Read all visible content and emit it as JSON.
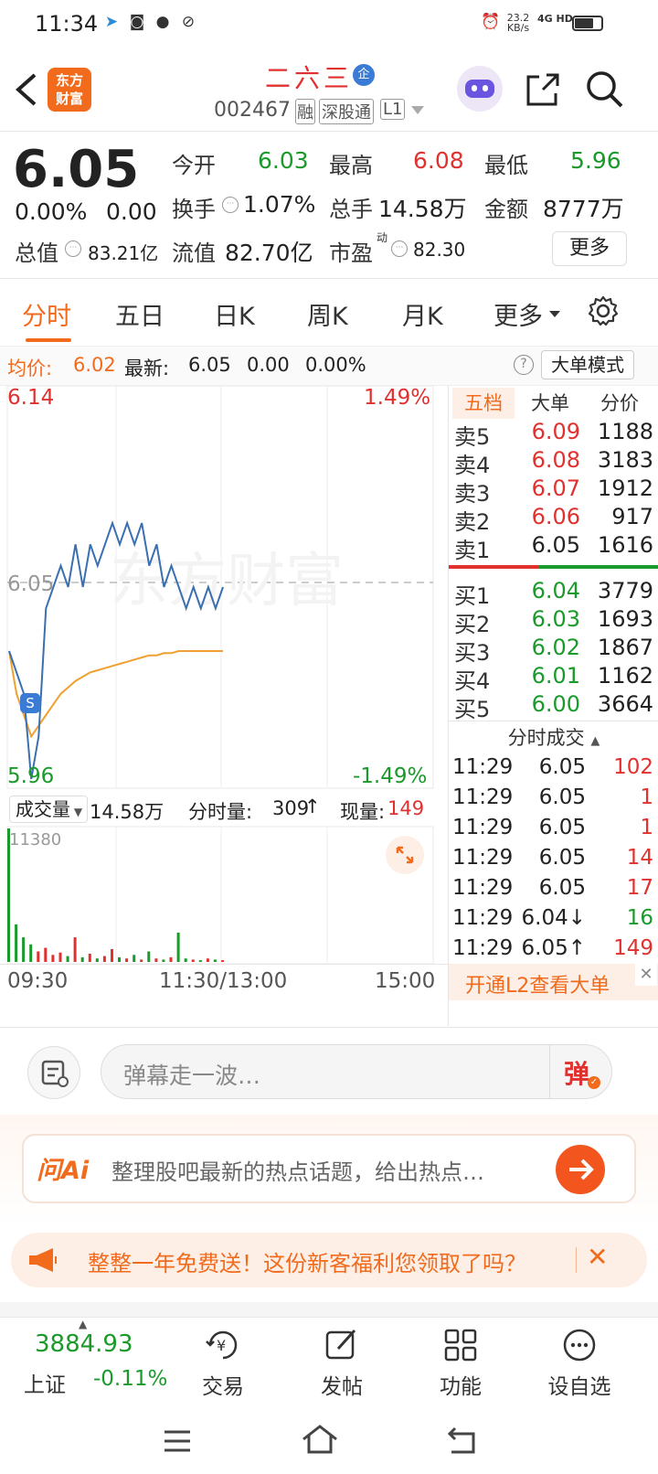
{
  "status_bar": {
    "time": "11:34",
    "net_speed": "23.2",
    "net_unit": "KB/s",
    "network": "4G HD"
  },
  "header": {
    "back": "<",
    "logo_line1": "东方",
    "logo_line2": "财富",
    "title": "二六三",
    "title_badge": "企",
    "code": "002467",
    "tags": [
      "融",
      "深股通",
      "L1"
    ]
  },
  "quote": {
    "price": "6.05",
    "change_pct": "0.00%",
    "change": "0.00",
    "open_label": "今开",
    "open": "6.03",
    "high_label": "最高",
    "high": "6.08",
    "low_label": "最低",
    "low": "5.96",
    "turnover_label": "换手",
    "turnover": "1.07%",
    "volume_label": "总手",
    "volume": "14.58万",
    "amount_label": "金额",
    "amount": "8777万",
    "mktcap_label": "总值",
    "mktcap": "83.21亿",
    "float_label": "流值",
    "float_cap": "82.70亿",
    "pe_label": "市盈",
    "pe_sup": "动",
    "pe": "82.30",
    "more_btn": "更多"
  },
  "tabs": [
    "分时",
    "五日",
    "日K",
    "周K",
    "月K",
    "更多"
  ],
  "avg_bar": {
    "avg_label": "均价:",
    "avg": "6.02",
    "latest_label": "最新:",
    "latest": "6.05",
    "chg": "0.00",
    "chg_pct": "0.00%",
    "mode_btn": "大单模式"
  },
  "chart_data": {
    "type": "line",
    "price_top": "6.14",
    "price_mid": "6.05",
    "price_bot": "5.96",
    "pct_top": "1.49%",
    "pct_bot": "-1.49%",
    "ylim": [
      5.96,
      6.14
    ],
    "prev_close": 6.05,
    "price_series": [
      6.02,
      6.01,
      6.0,
      5.96,
      5.98,
      6.04,
      6.05,
      6.06,
      6.05,
      6.07,
      6.05,
      6.07,
      6.06,
      6.07,
      6.08,
      6.07,
      6.08,
      6.07,
      6.08,
      6.06,
      6.07,
      6.05,
      6.06,
      6.05,
      6.04,
      6.05,
      6.04,
      6.05,
      6.04,
      6.05
    ],
    "avg_series": [
      6.02,
      6.0,
      5.99,
      5.98,
      5.985,
      5.99,
      5.995,
      6.0,
      6.003,
      6.006,
      6.008,
      6.01,
      6.011,
      6.012,
      6.013,
      6.014,
      6.015,
      6.016,
      6.017,
      6.018,
      6.018,
      6.019,
      6.019,
      6.02,
      6.02,
      6.02,
      6.02,
      6.02,
      6.02,
      6.02
    ],
    "volume_max": "11380",
    "volume_series": [
      11380,
      3200,
      2100,
      1500,
      900,
      1200,
      600,
      800,
      500,
      2100,
      400,
      700,
      300,
      500,
      1100,
      400,
      300,
      600,
      200,
      900,
      300,
      200,
      400,
      2500,
      300,
      200,
      150,
      300,
      200,
      149
    ],
    "x_labels": [
      "09:30",
      "11:30/13:00",
      "15:00"
    ],
    "volume_label": "成交量",
    "volume_total": "14.58万",
    "min_volume_label": "分时量:",
    "min_volume": "309",
    "cur_volume_label": "现量:",
    "cur_volume": "149"
  },
  "order_book": {
    "tabs": [
      "五档",
      "大单",
      "分价"
    ],
    "asks": [
      {
        "label": "卖5",
        "price": "6.09",
        "vol": "1188"
      },
      {
        "label": "卖4",
        "price": "6.08",
        "vol": "3183"
      },
      {
        "label": "卖3",
        "price": "6.07",
        "vol": "1912"
      },
      {
        "label": "卖2",
        "price": "6.06",
        "vol": "917"
      },
      {
        "label": "卖1",
        "price": "6.05",
        "vol": "1616"
      }
    ],
    "bids": [
      {
        "label": "买1",
        "price": "6.04",
        "vol": "3779"
      },
      {
        "label": "买2",
        "price": "6.03",
        "vol": "1693"
      },
      {
        "label": "买3",
        "price": "6.02",
        "vol": "1867"
      },
      {
        "label": "买4",
        "price": "6.01",
        "vol": "1162"
      },
      {
        "label": "买5",
        "price": "6.00",
        "vol": "3664"
      }
    ],
    "trades_title": "分时成交",
    "trades": [
      {
        "time": "11:29",
        "price": "6.05",
        "vol": "102"
      },
      {
        "time": "11:29",
        "price": "6.05",
        "vol": "1"
      },
      {
        "time": "11:29",
        "price": "6.05",
        "vol": "1"
      },
      {
        "time": "11:29",
        "price": "6.05",
        "vol": "14"
      },
      {
        "time": "11:29",
        "price": "6.05",
        "vol": "17"
      },
      {
        "time": "11:29",
        "price": "6.04↓",
        "vol": "16"
      },
      {
        "time": "11:29",
        "price": "6.05↑",
        "vol": "149"
      }
    ],
    "l2_btn": "开通L2查看大单"
  },
  "danmu": {
    "placeholder": "弹幕走一波…",
    "send": "弹"
  },
  "ai": {
    "logo": "问Ai",
    "text": "整理股吧最新的热点话题，给出热点…"
  },
  "promo": {
    "text": "整整一年免费送！这份新客福利您领取了吗？"
  },
  "bottom_nav": {
    "index_value": "3884.93",
    "index_name": "上证",
    "index_chg": "-0.11%",
    "items": [
      "交易",
      "发帖",
      "功能",
      "设自选"
    ]
  }
}
